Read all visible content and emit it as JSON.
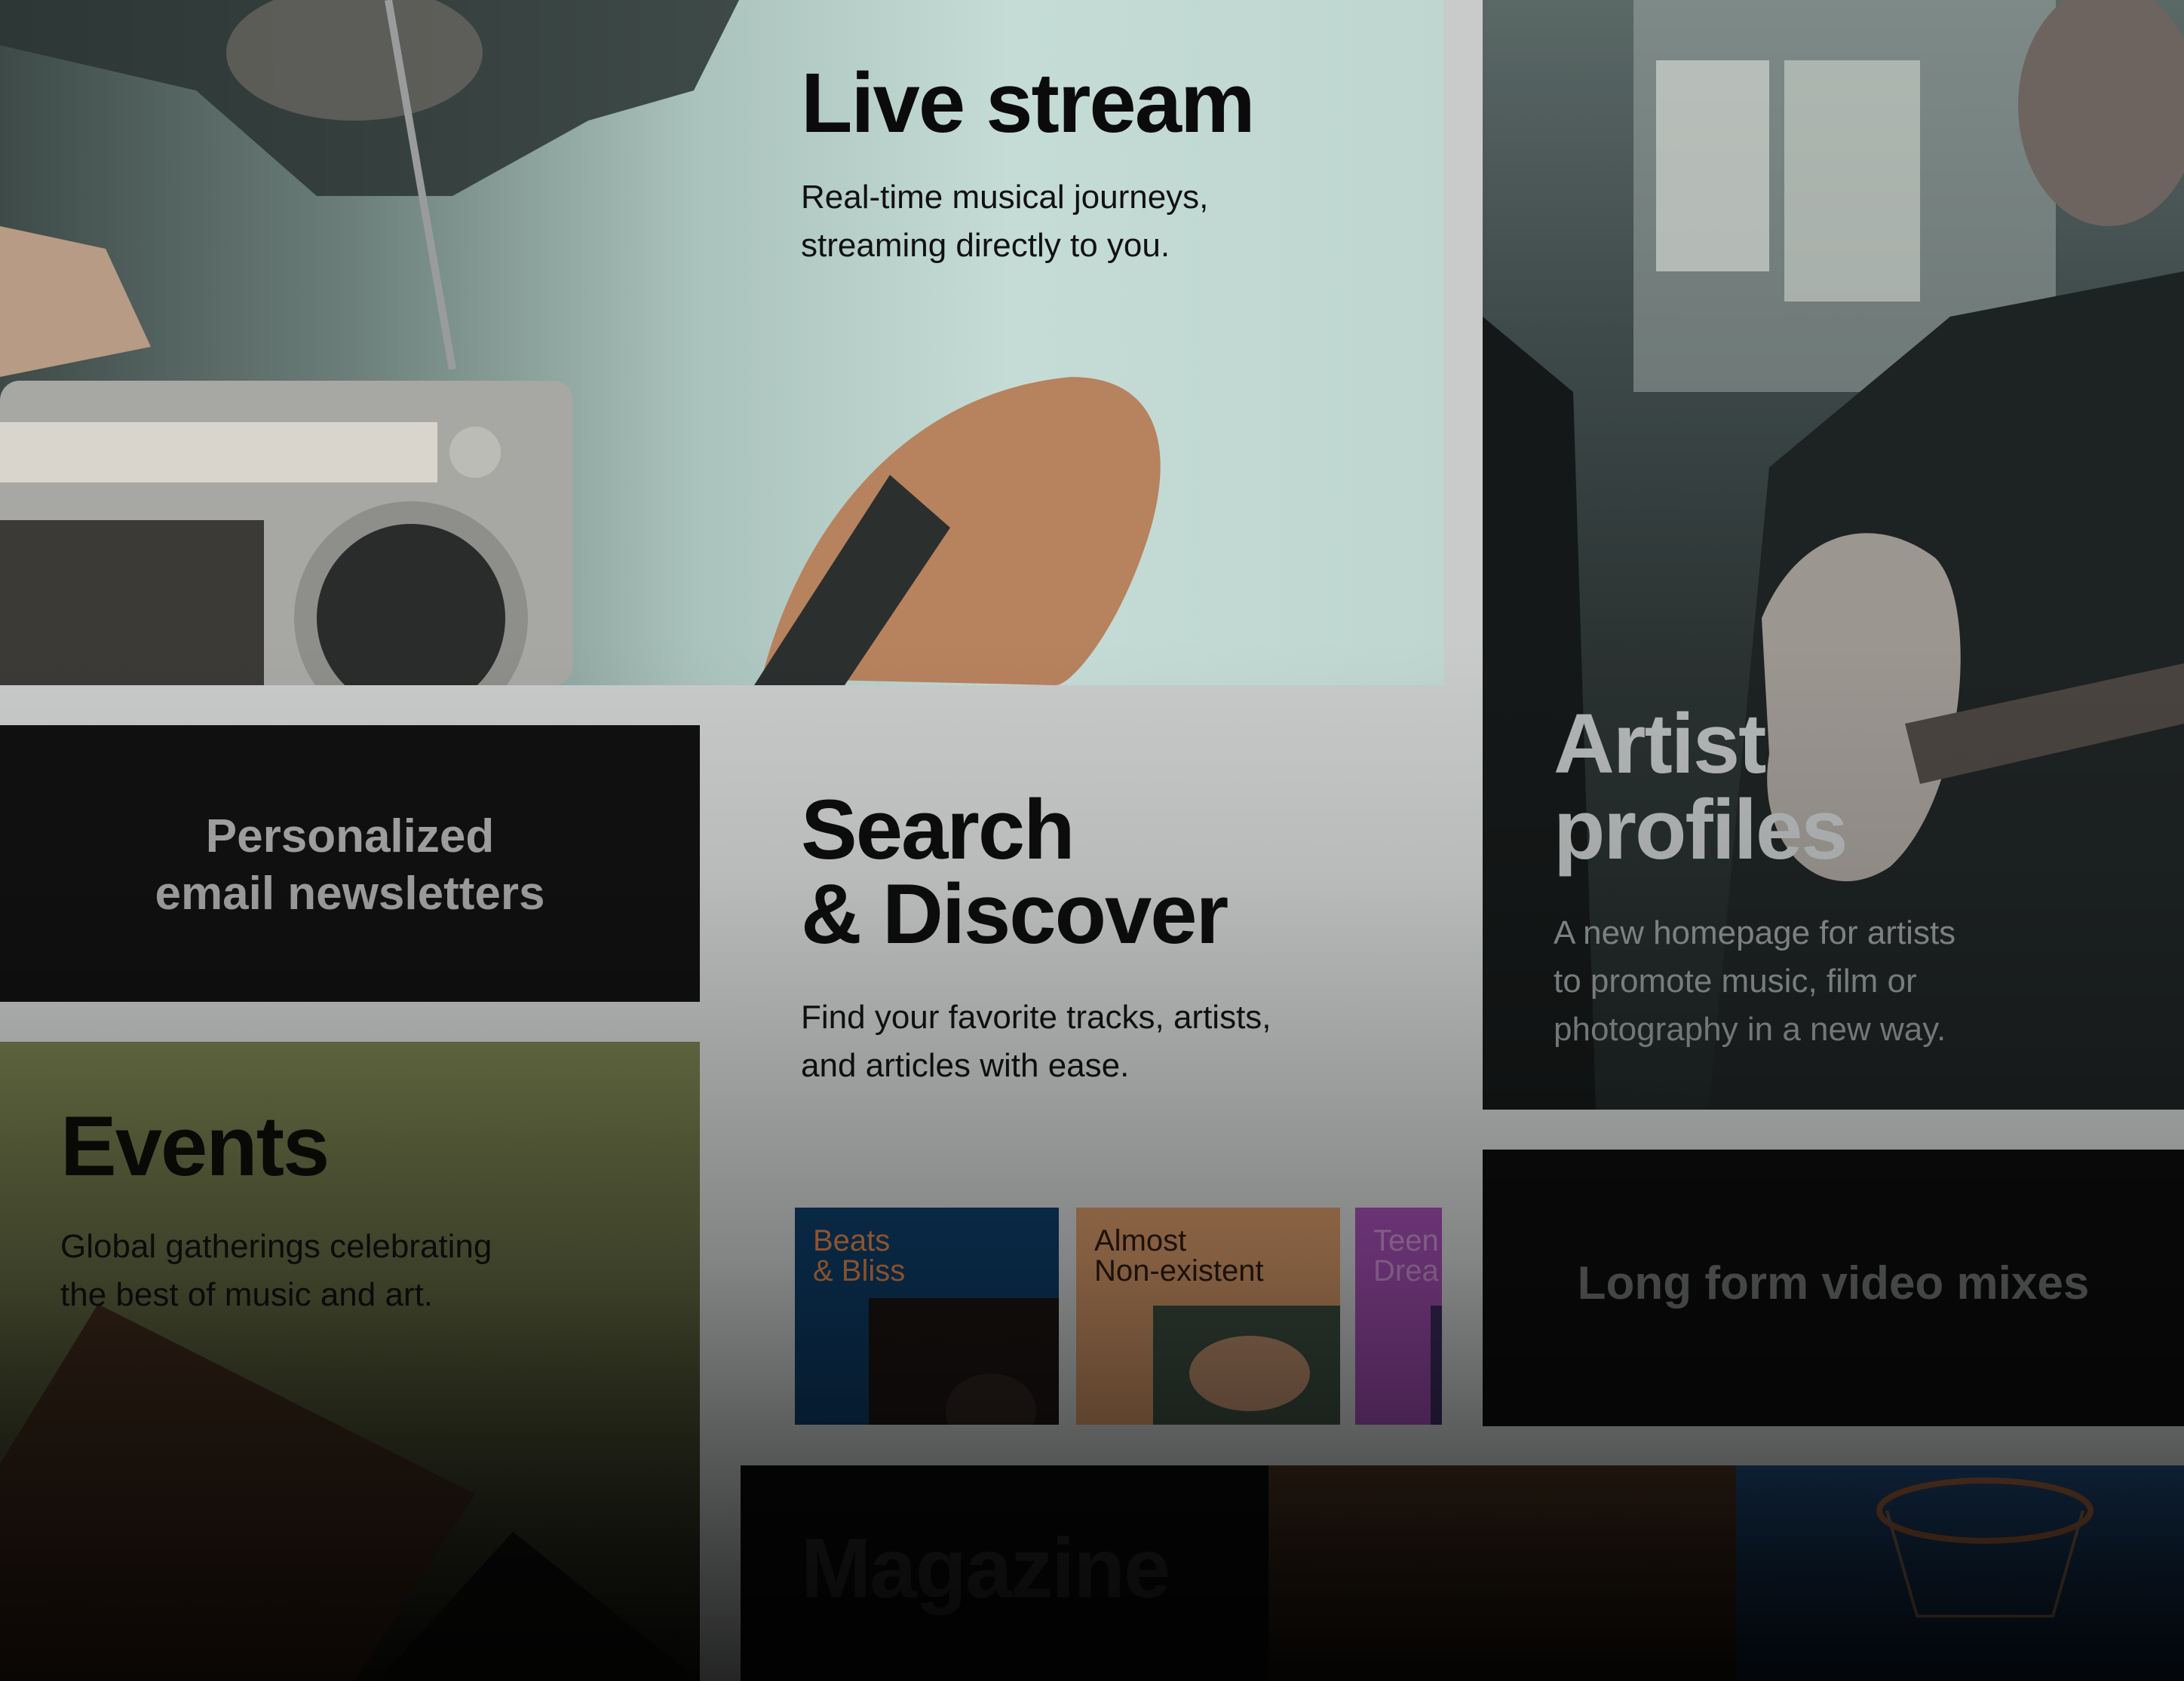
{
  "cards": {
    "live_stream": {
      "title": "Live stream",
      "description": "Real-time musical journeys,\nstreaming directly to you."
    },
    "artist_profiles": {
      "title": "Artist\nprofiles",
      "description": "A new homepage for artists\nto promote music, film or\nphotography in a new way."
    },
    "newsletters": {
      "title": "Personalized\nemail newsletters"
    },
    "search_discover": {
      "title": "Search\n& Discover",
      "description": "Find your favorite tracks, artists,\nand articles with ease."
    },
    "events": {
      "title": "Events",
      "description": "Global gatherings celebrating\nthe best of music and art."
    },
    "long_form_video": {
      "title": "Long form video mixes"
    },
    "magazine": {
      "title": "Magazine"
    }
  },
  "playlists": [
    {
      "label": "Beats\n& Bliss",
      "color": "#0d3a63"
    },
    {
      "label": "Almost\nNon-existent",
      "color": "#c88f62"
    },
    {
      "label": "Teen\nDrea",
      "color": "#9a4aa9"
    }
  ]
}
